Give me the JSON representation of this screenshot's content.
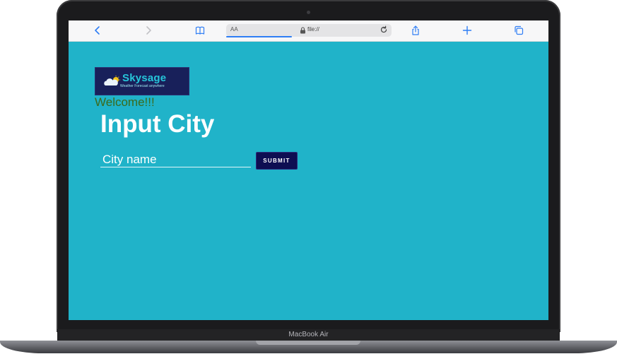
{
  "device": {
    "label": "MacBook Air"
  },
  "browser": {
    "address": {
      "text_size_label": "AA",
      "url": "file://"
    },
    "toolbar": {
      "back_icon": "chevron-left-icon",
      "forward_icon": "chevron-right-icon",
      "bookmarks_icon": "book-icon",
      "share_icon": "share-icon",
      "new_tab_icon": "plus-icon",
      "tabs_icon": "tabs-icon"
    }
  },
  "app": {
    "logo": {
      "name": "Skysage",
      "tagline": "Weather Forecast anywhere"
    },
    "welcome": "Welcome!!!",
    "heading": "Input City",
    "city_input": {
      "placeholder": "City name",
      "value": ""
    },
    "submit_label": "SUBMIT"
  },
  "colors": {
    "page_background": "#20b3c9",
    "heading": "#ffffff",
    "welcome_text": "#3b6a1c",
    "button_background": "#0e0e52",
    "logo_background": "#18205a",
    "browser_accent": "#2f7ef5"
  }
}
